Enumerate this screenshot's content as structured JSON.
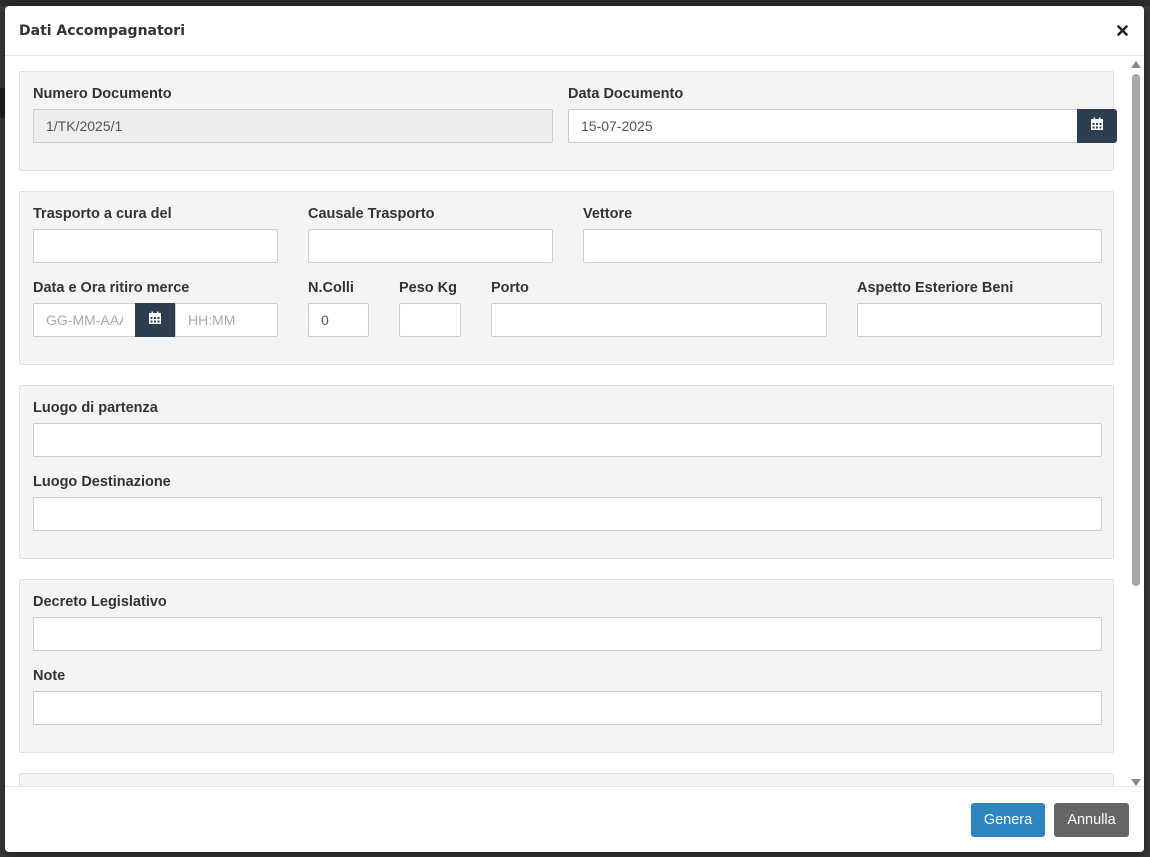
{
  "modal": {
    "title": "Dati Accompagnatori"
  },
  "document": {
    "number_label": "Numero Documento",
    "number_value": "1/TK/2025/1",
    "date_label": "Data Documento",
    "date_value": "15-07-2025"
  },
  "transport": {
    "cura_label": "Trasporto a cura del",
    "causale_label": "Causale Trasporto",
    "vettore_label": "Vettore",
    "ritiro_label": "Data e Ora ritiro merce",
    "ritiro_date_placeholder": "GG-MM-AAAA",
    "ritiro_time_placeholder": "HH:MM",
    "colli_label": "N.Colli",
    "colli_value": "0",
    "peso_label": "Peso Kg",
    "porto_label": "Porto",
    "aspetto_label": "Aspetto Esteriore Beni"
  },
  "places": {
    "partenza_label": "Luogo di partenza",
    "destinazione_label": "Luogo Destinazione"
  },
  "legal": {
    "decreto_label": "Decreto Legislativo",
    "note_label": "Note"
  },
  "footer": {
    "genera_label": "Genera",
    "annulla_label": "Annulla"
  },
  "colors": {
    "primary": "#2e86c1",
    "calendar_button": "#2d3e50",
    "cancel_button": "#666666"
  }
}
